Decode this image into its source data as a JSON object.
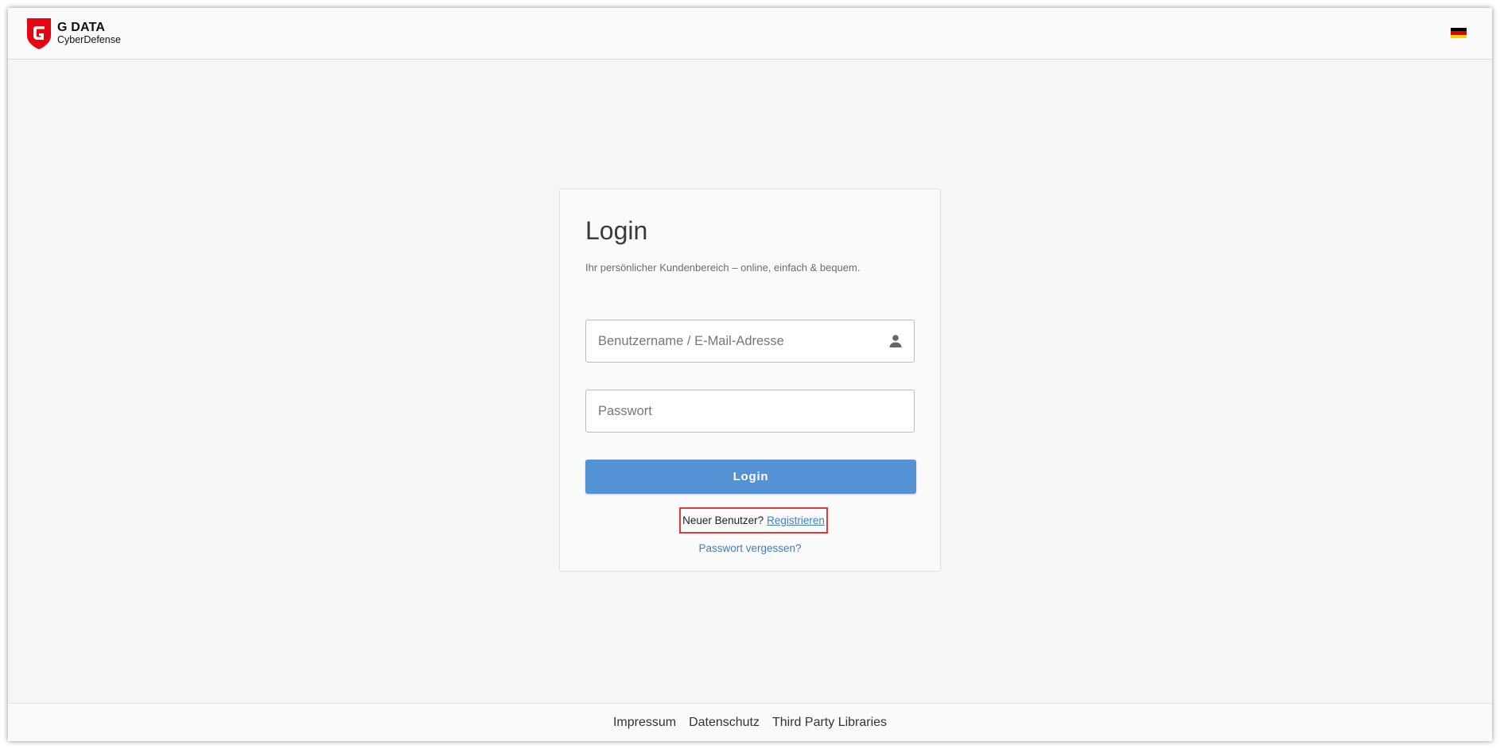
{
  "header": {
    "brand": "G DATA",
    "brand_sub": "CyberDefense",
    "language_flag": "german-flag-icon"
  },
  "login": {
    "title": "Login",
    "subtitle": "Ihr persönlicher Kundenbereich – online, einfach & bequem.",
    "username_placeholder": "Benutzername / E-Mail-Adresse",
    "password_placeholder": "Passwort",
    "submit_label": "Login",
    "new_user_text": "Neuer Benutzer?",
    "register_link": "Registrieren",
    "forgot_password_link": "Passwort vergessen?"
  },
  "footer": {
    "links": [
      "Impressum",
      "Datenschutz",
      "Third Party Libraries"
    ]
  },
  "colors": {
    "brand_red": "#e30613",
    "button_blue": "#5592d4",
    "link_blue": "#3f7fc6",
    "highlight_red": "#e03a3a",
    "page_bg": "#f5f6f8"
  }
}
